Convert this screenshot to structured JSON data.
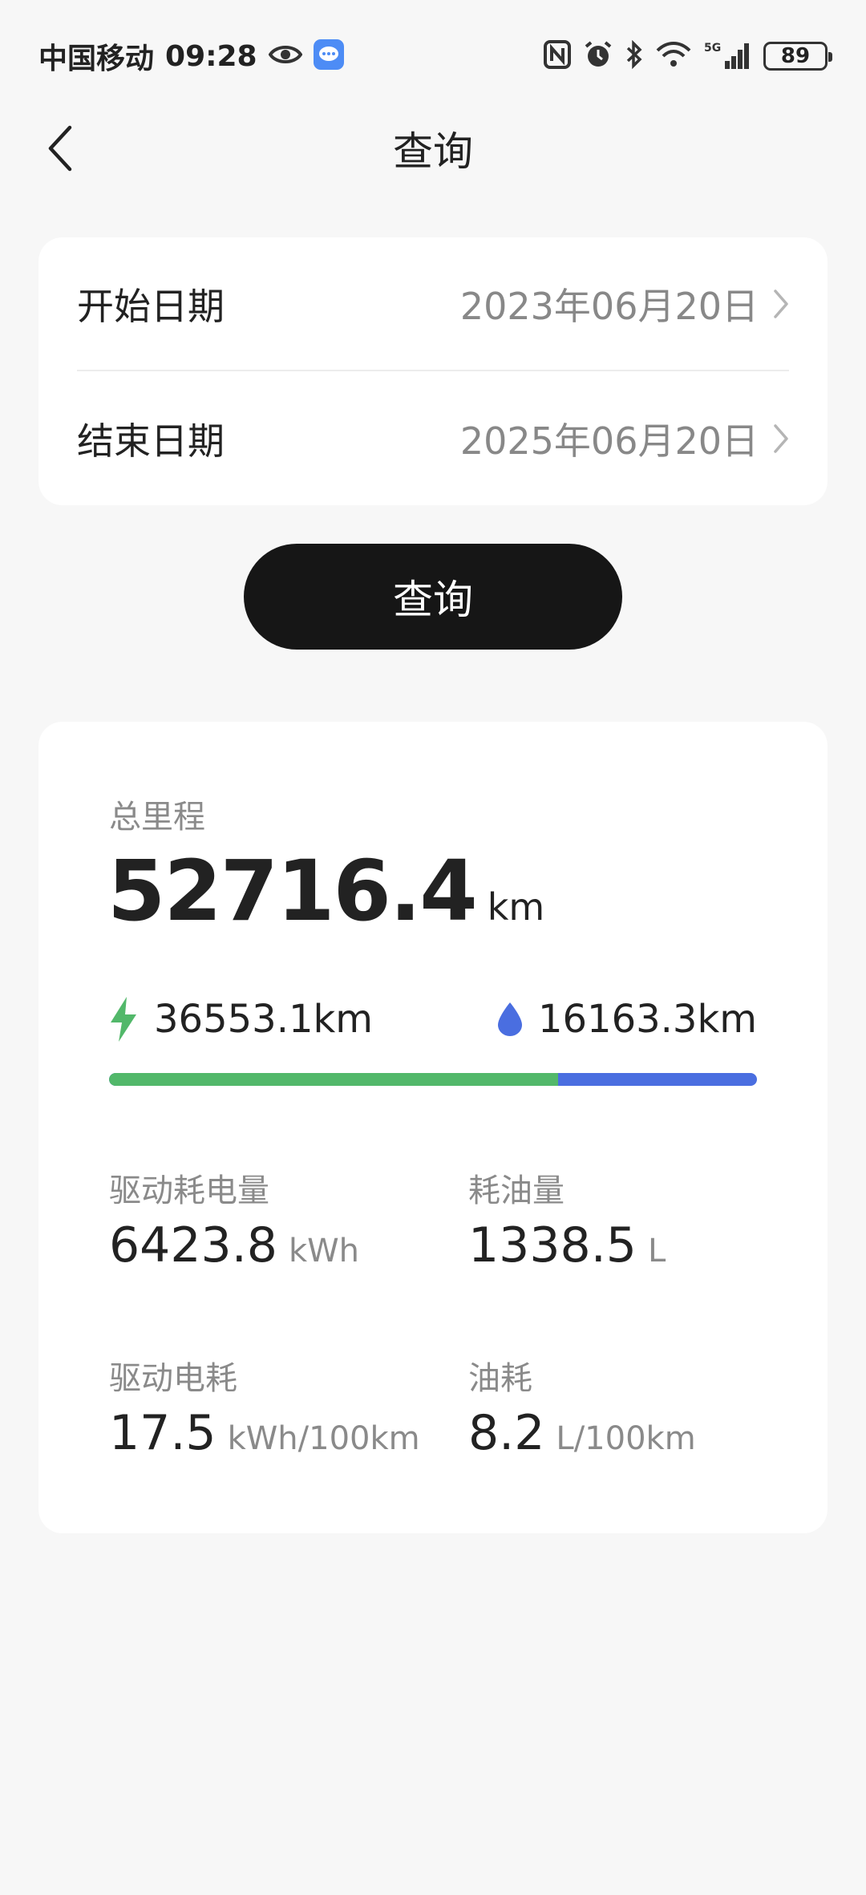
{
  "status_bar": {
    "carrier": "中国移动",
    "time": "09:28",
    "network": "5G",
    "battery": "89"
  },
  "nav": {
    "title": "查询"
  },
  "date_range": {
    "start_label": "开始日期",
    "start_value": "2023年06月20日",
    "end_label": "结束日期",
    "end_value": "2025年06月20日"
  },
  "query_button": {
    "label": "查询"
  },
  "stats": {
    "total_label": "总里程",
    "total_value": "52716.4",
    "total_unit": "km",
    "electric_distance": "36553.1km",
    "fuel_distance": "16163.3km",
    "electric_share_percent": 69.3,
    "metrics": [
      {
        "label": "驱动耗电量",
        "value": "6423.8",
        "unit": "kWh"
      },
      {
        "label": "耗油量",
        "value": "1338.5",
        "unit": "L"
      },
      {
        "label": "驱动电耗",
        "value": "17.5",
        "unit": "kWh/100km"
      },
      {
        "label": "油耗",
        "value": "8.2",
        "unit": "L/100km"
      }
    ]
  },
  "colors": {
    "electric": "#52b86a",
    "fuel": "#4a6ee0",
    "button": "#161616"
  }
}
